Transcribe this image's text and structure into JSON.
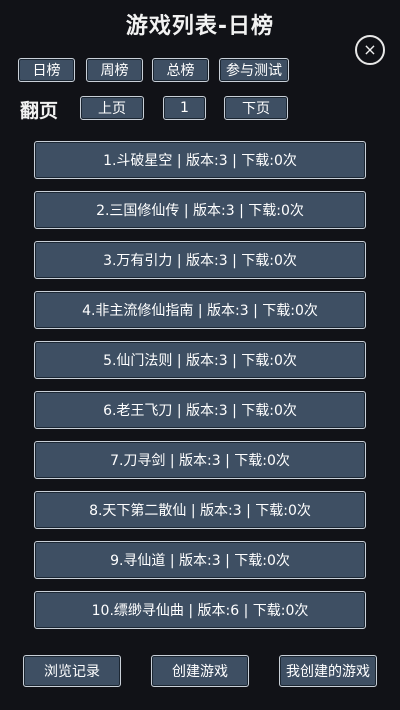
{
  "header": {
    "title": "游戏列表-日榜",
    "close_icon": "×"
  },
  "tabs": [
    {
      "label": "日榜"
    },
    {
      "label": "周榜"
    },
    {
      "label": "总榜"
    },
    {
      "label": "参与测试"
    }
  ],
  "pager": {
    "label": "翻页",
    "prev_label": "上页",
    "page_number": "1",
    "next_label": "下页"
  },
  "games": [
    {
      "text": "1.斗破星空 | 版本:3 | 下载:0次"
    },
    {
      "text": "2.三国修仙传 | 版本:3 | 下载:0次"
    },
    {
      "text": "3.万有引力 | 版本:3 | 下载:0次"
    },
    {
      "text": "4.非主流修仙指南 | 版本:3 | 下载:0次"
    },
    {
      "text": "5.仙门法则 | 版本:3 | 下载:0次"
    },
    {
      "text": "6.老王飞刀 | 版本:3 | 下载:0次"
    },
    {
      "text": "7.刀寻剑 | 版本:3 | 下载:0次"
    },
    {
      "text": "8.天下第二散仙 | 版本:3 | 下载:0次"
    },
    {
      "text": "9.寻仙道 | 版本:3 | 下载:0次"
    },
    {
      "text": "10.缥缈寻仙曲 | 版本:6 | 下载:0次"
    }
  ],
  "footer": {
    "history_label": "浏览记录",
    "create_label": "创建游戏",
    "my_games_label": "我创建的游戏"
  },
  "colors": {
    "background": "#111217",
    "button_fill": "#3e4f63",
    "button_border": "#c9d0d8"
  }
}
